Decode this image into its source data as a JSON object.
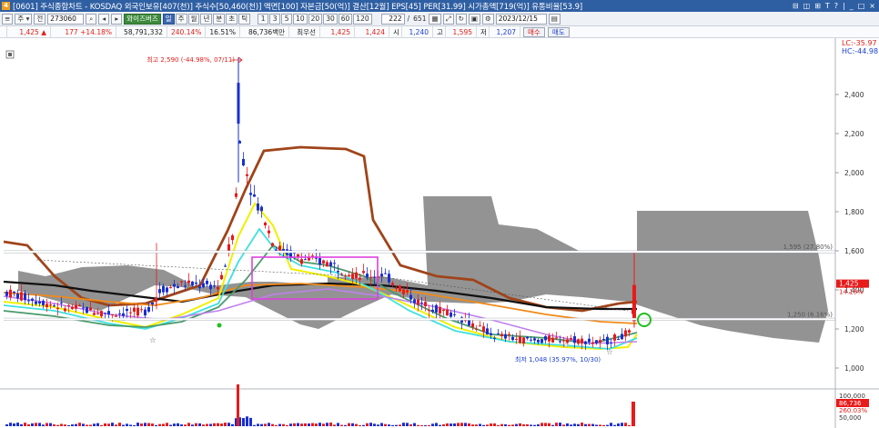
{
  "titlebar": {
    "badge": "4",
    "text": "[0601] 주식종합차트 - KOSDAQ 외국인보유[407(천)] 주식수[50,460(천)] 액면[100] 자본금[50(억)] 결산[12월] EPS[45] PER[31.99] 시가총액[719(억)] 유통비율[53.9]",
    "controls": [
      "⊟",
      "◫",
      "⊞",
      "T",
      "?",
      "|",
      "_",
      "□",
      "×"
    ]
  },
  "toolbar1": {
    "menu_btn": "≡",
    "type_select": "주 ▾",
    "jeon_btn": "전",
    "code": "273060",
    "stock_name": "와이즈버즈",
    "period_tabs": [
      "일",
      "주",
      "월",
      "년",
      "분",
      "초",
      "틱"
    ],
    "active_period": "일",
    "intervals": [
      "1",
      "3",
      "5",
      "10",
      "20",
      "30",
      "60",
      "120"
    ],
    "count": "222",
    "total": "651",
    "date": "2023/12/15"
  },
  "toolbar2": {
    "price": "1,425",
    "change": "177",
    "change_pct": "+14.18%",
    "volume": "58,791,332",
    "vol_ratio": "240.14%",
    "turnover": "16.51%",
    "amount": "86,736백만",
    "best_label": "최우선",
    "ask": "1,425",
    "bid": "1,424",
    "open_label": "시",
    "open": "1,240",
    "high_label": "고",
    "high": "1,595",
    "low_label": "저",
    "low": "1,207",
    "buy_label": "매수",
    "sell_label": "매도"
  },
  "chart": {
    "lc_label": "LC:-35.97",
    "hc_label": "HC:-44.98",
    "high_annotation": "최고 2,590 (-44.98%, 07/11)",
    "low_annotation": "최저 1,048 (35.97%, 10/30)",
    "upper_line_label": "1,595 (27.80%)",
    "lower_line_label": "1,250 (6.16%)",
    "current_price_tag": "1,425",
    "current_pct_tag": "14.18%",
    "volume_tags": [
      "100,000",
      "86,736",
      "260.03%",
      "50,000"
    ],
    "colors": {
      "up": "#e81a1a",
      "down": "#1a2fd0",
      "cloud": "#808080",
      "highlight": "#e040e0",
      "ma_black": "#111111",
      "ma_brown": "#a0441a",
      "ma_orange": "#f08a1a",
      "ma_yellow": "#f0f000",
      "ma_cyan": "#40e0e0",
      "ma_green": "#4a9a6a",
      "ma_violet": "#c080f0"
    }
  },
  "chart_data": {
    "type": "candlestick",
    "yaxis_ticks": [
      "2,400",
      "2,200",
      "2,000",
      "1,800",
      "1,600",
      "1,400",
      "1,200",
      "1,000"
    ],
    "ylim": [
      980,
      2520
    ],
    "horizontal_levels": [
      1595,
      1250
    ],
    "current_price": 1425
  }
}
